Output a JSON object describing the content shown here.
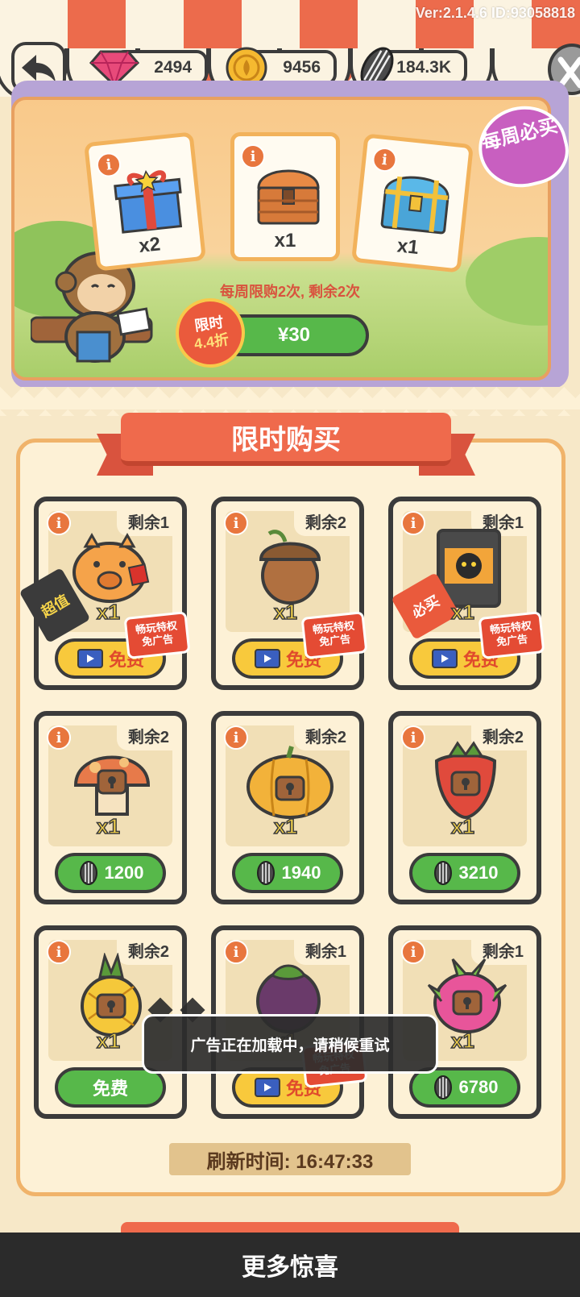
{
  "header": {
    "version": "Ver:2.1.4.6 ID:93058818",
    "currencies": [
      {
        "icon": "gem-icon",
        "value": "2494",
        "color": "#e84a7a"
      },
      {
        "icon": "gold-coin-icon",
        "value": "9456",
        "color": "#f5b930"
      },
      {
        "icon": "sunflower-seed-icon",
        "value": "184.3K",
        "color": "#555555"
      }
    ]
  },
  "weekly_pack": {
    "badge": "每周必买",
    "items": [
      {
        "icon": "gift-box-icon",
        "qty": "x2"
      },
      {
        "icon": "wooden-chest-icon",
        "qty": "x1"
      },
      {
        "icon": "golden-chest-icon",
        "qty": "x1"
      }
    ],
    "limit_text": "每周限购2次, 剩余2次",
    "sale_badge_top": "限时",
    "sale_badge_bottom": "4.4折",
    "price": "¥30"
  },
  "shop": {
    "title": "限时购买",
    "vip_label_line1": "畅玩特权",
    "vip_label_line2": "免广告",
    "items": [
      {
        "name": "piggy-bank",
        "stock": "剩余1",
        "qty": "x1",
        "button": "免费",
        "button_type": "ad",
        "vip": true,
        "side_tag": "超值"
      },
      {
        "name": "acorn",
        "stock": "剩余2",
        "qty": "x1",
        "button": "免费",
        "button_type": "ad",
        "vip": true
      },
      {
        "name": "seed-bag",
        "stock": "剩余1",
        "qty": "x1",
        "button": "免费",
        "button_type": "ad",
        "vip": true,
        "side_tag": "必买"
      },
      {
        "name": "mushroom",
        "stock": "剩余2",
        "qty": "x1",
        "button": "1200",
        "button_type": "seed"
      },
      {
        "name": "pumpkin",
        "stock": "剩余2",
        "qty": "x1",
        "button": "1940",
        "button_type": "seed"
      },
      {
        "name": "strawberry",
        "stock": "剩余2",
        "qty": "x1",
        "button": "3210",
        "button_type": "seed"
      },
      {
        "name": "pineapple",
        "stock": "剩余2",
        "qty": "x1",
        "button": "免费",
        "button_type": "free"
      },
      {
        "name": "mangosteen",
        "stock": "剩余1",
        "qty": "x1",
        "button": "免费",
        "button_type": "ad",
        "vip": true
      },
      {
        "name": "dragon-fruit",
        "stock": "剩余1",
        "qty": "x1",
        "button": "6780",
        "button_type": "seed"
      }
    ],
    "refresh_label": "刷新时间: 16:47:33"
  },
  "toast": "广告正在加载中，请稍候重试",
  "bottom_bar": "更多惊喜"
}
